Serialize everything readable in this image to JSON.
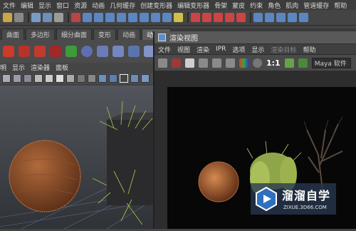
{
  "main_menu": [
    "文件",
    "编辑",
    "显示",
    "窗口",
    "资源",
    "动画",
    "几何缓存",
    "创建变形器",
    "编辑变形器",
    "骨架",
    "蒙皮",
    "约束",
    "角色",
    "肌肉",
    "管道缓存",
    "帮助"
  ],
  "shelf_tabs": [
    "曲面",
    "多边形",
    "细分曲面",
    "变形",
    "动画",
    "动力学"
  ],
  "active_shelf_tab": "动力学",
  "viewport_menu": [
    "明",
    "显示",
    "渲染器",
    "面板"
  ],
  "render_window": {
    "title": "渲染视图",
    "menu": [
      "文件",
      "视图",
      "渲染",
      "IPR",
      "选项",
      "显示",
      "渲染目标",
      "帮助"
    ],
    "disabled_menu": [
      "渲染目标"
    ],
    "ratio_label": "1:1",
    "camera_select": "Maya 软件"
  },
  "watermark": {
    "title": "溜溜自学",
    "subtitle": "ZIXUE.3D66.COM"
  },
  "colors": {
    "accent": "#5a8fc8",
    "render_background": "#070707",
    "hair_orange": "#c8763f",
    "grass_green": "#9dbb4a"
  }
}
